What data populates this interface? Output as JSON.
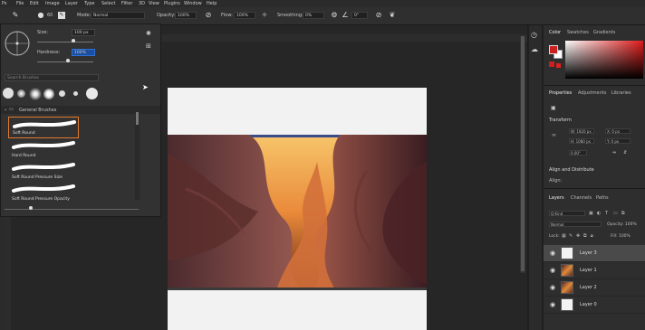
{
  "menu": {
    "items": [
      "File",
      "Edit",
      "Image",
      "Layer",
      "Type",
      "Select",
      "Filter",
      "3D",
      "View",
      "Plugins",
      "Window",
      "Help"
    ]
  },
  "options_bar": {
    "brush_size": "60",
    "mode_label": "Mode:",
    "mode_value": "Normal",
    "opacity_label": "Opacity:",
    "opacity_value": "100%",
    "flow_label": "Flow:",
    "flow_value": "100%",
    "smoothing_label": "Smoothing:",
    "smoothing_value": "0%",
    "angle_value": "0°"
  },
  "brush_picker": {
    "size_label": "Size:",
    "size_value": "100 px",
    "hardness_label": "Hardness:",
    "hardness_value": "100%",
    "search_placeholder": "Search Brushes",
    "folder_label": "General Brushes",
    "strokes": [
      {
        "label": "Soft Round"
      },
      {
        "label": "Hard Round"
      },
      {
        "label": "Soft Round Pressure Size"
      },
      {
        "label": "Soft Round Pressure Opacity"
      }
    ]
  },
  "color_panel": {
    "tabs": [
      "Color",
      "Swatches",
      "Gradients"
    ],
    "foreground": "#cc1f1f",
    "background": "#ffffff",
    "hue": "#e01b1b"
  },
  "properties_panel": {
    "tabs": [
      "Properties",
      "Adjustments",
      "Libraries"
    ],
    "section_transform": "Transform",
    "w_value": "W: 1920 px",
    "h_value": "H: 1080 px",
    "x_value": "X: 0 px",
    "y_value": "Y: 0 px",
    "angle_value": "0.00°",
    "section_align": "Align and Distribute",
    "align_label": "Align:"
  },
  "layers_panel": {
    "tabs": [
      "Layers",
      "Channels",
      "Paths"
    ],
    "filter_label": "Q Kind",
    "blend_mode": "Normal",
    "opacity": "Opacity: 100%",
    "lock_label": "Lock:",
    "fill": "Fill: 100%",
    "layers": [
      {
        "name": "Layer 3",
        "thumb": "white"
      },
      {
        "name": "Layer 1",
        "thumb": "photo"
      },
      {
        "name": "Layer 2",
        "thumb": "photo"
      },
      {
        "name": "Layer 0",
        "thumb": "white"
      }
    ]
  }
}
